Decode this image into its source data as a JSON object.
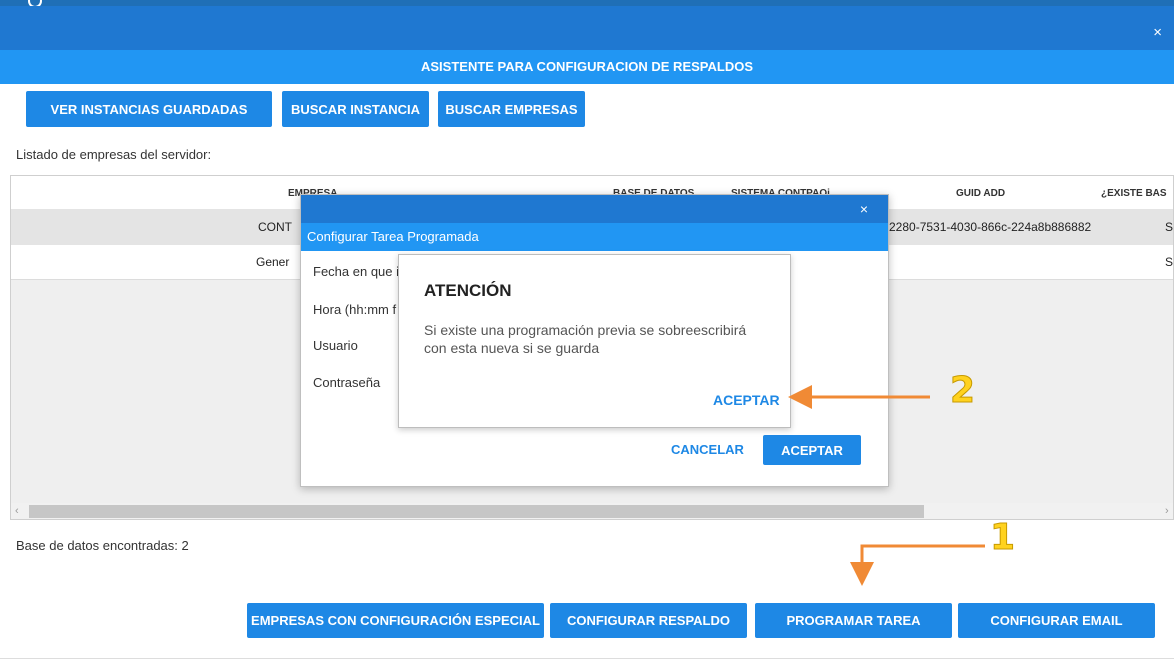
{
  "window": {
    "close_glyph": "×"
  },
  "banner": {
    "title": "ASISTENTE PARA CONFIGURACION DE RESPALDOS"
  },
  "toolbar": {
    "ver_instancias": "VER INSTANCIAS GUARDADAS",
    "buscar_instancia": "BUSCAR INSTANCIA",
    "buscar_empresas": "BUSCAR EMPRESAS"
  },
  "list_label": "Listado de empresas del servidor:",
  "table": {
    "headers": {
      "empresa": "EMPRESA",
      "base_datos": "BASE DE DATOS",
      "sistema": "SISTEMA CONTPAQi",
      "guid": "GUID ADD",
      "existe": "¿EXISTE BAS"
    },
    "rows": [
      {
        "empresa": "CONT",
        "guid": "2280-7531-4030-866c-224a8b886882",
        "existe": "S"
      },
      {
        "empresa": "Gener",
        "guid": "",
        "existe": "S"
      }
    ],
    "scroll_left": "‹",
    "scroll_right": "›"
  },
  "dialog": {
    "title": "Configurar Tarea Programada",
    "close_glyph": "×",
    "fields": {
      "fecha": "Fecha en que i",
      "hora": "Hora (hh:mm f",
      "usuario": "Usuario",
      "contrasena": "Contraseña"
    },
    "cancel_label": "CANCELAR",
    "accept_label": "ACEPTAR"
  },
  "alert": {
    "title": "ATENCIÓN",
    "message": "Si existe una programación previa se sobreescribirá con esta nueva si se guarda",
    "accept_label": "ACEPTAR"
  },
  "footer": {
    "db_found": "Base de datos encontradas: 2",
    "empresas_especial": "EMPRESAS CON CONFIGURACIÓN ESPECIAL",
    "configurar_respaldo": "CONFIGURAR RESPALDO",
    "programar_tarea": "PROGRAMAR TAREA",
    "configurar_email": "CONFIGURAR EMAIL"
  },
  "annotations": {
    "step1": "1",
    "step2": "2",
    "arrow_color": "#f08a35",
    "number_color": "#ffd21f"
  },
  "colors": {
    "primary": "#1e88e5",
    "banner": "#2196f3",
    "titlebar": "#1f78d1"
  }
}
